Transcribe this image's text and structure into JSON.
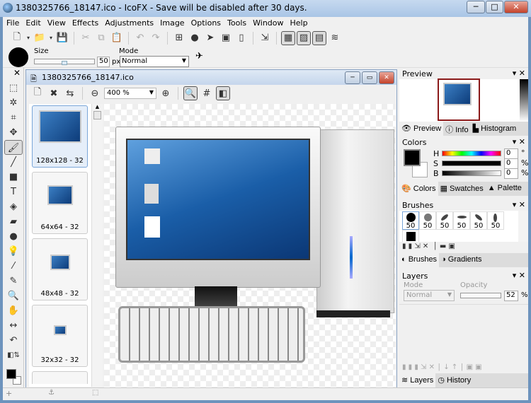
{
  "window": {
    "title": "1380325766_18147.ico - IcoFX - Save will be disabled after 30 days.",
    "min": "─",
    "max": "□",
    "close": "✕"
  },
  "menu": [
    "File",
    "Edit",
    "View",
    "Effects",
    "Adjustments",
    "Image",
    "Options",
    "Tools",
    "Window",
    "Help"
  ],
  "options": {
    "size_label": "Size",
    "size_value": "50",
    "size_unit": "px",
    "mode_label": "Mode",
    "mode_value": "Normal",
    "brush_fraction": 0.5
  },
  "document": {
    "title": "1380325766_18147.ico",
    "zoom": "400 %",
    "thumbnails": [
      {
        "label": "128x128 - 32"
      },
      {
        "label": "64x64 - 32"
      },
      {
        "label": "48x48 - 32"
      },
      {
        "label": "32x32 - 32"
      }
    ]
  },
  "panels": {
    "preview": {
      "title": "Preview",
      "tabs": [
        "Preview",
        "Info",
        "Histogram"
      ]
    },
    "colors": {
      "title": "Colors",
      "h_label": "H",
      "s_label": "S",
      "b_label": "B",
      "h": "0",
      "s": "0",
      "b": "0",
      "deg": "°",
      "pct": "%",
      "tabs": [
        "Colors",
        "Swatches",
        "Palette"
      ],
      "fg": "#000000"
    },
    "brushes": {
      "title": "Brushes",
      "sizes": [
        "50",
        "50",
        "50",
        "50",
        "50",
        "50"
      ],
      "tabs": [
        "Brushes",
        "Gradients"
      ]
    },
    "layers": {
      "title": "Layers",
      "mode_label": "Mode",
      "mode_value": "Normal",
      "opacity_label": "Opacity",
      "opacity": "52",
      "pct": "%",
      "tabs": [
        "Layers",
        "History"
      ]
    }
  },
  "status": {
    "cursor_icon": "+",
    "anchor_icon": "⚓",
    "selection_icon": "⬚"
  }
}
